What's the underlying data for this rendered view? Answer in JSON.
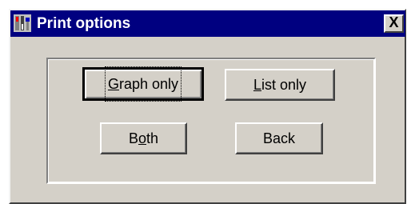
{
  "window": {
    "title": "Print options",
    "close_label": "X",
    "icon": "tools-app-icon"
  },
  "buttons": {
    "graph_only": {
      "prefix": "",
      "mnemonic": "G",
      "suffix": "raph only",
      "is_default": true
    },
    "list_only": {
      "prefix": "",
      "mnemonic": "L",
      "suffix": "ist only"
    },
    "both": {
      "prefix": "B",
      "mnemonic": "o",
      "suffix": "th"
    },
    "back": {
      "prefix": "Back",
      "mnemonic": "",
      "suffix": ""
    }
  },
  "colors": {
    "titlebar": "#000080",
    "face": "#d4d0c8"
  }
}
